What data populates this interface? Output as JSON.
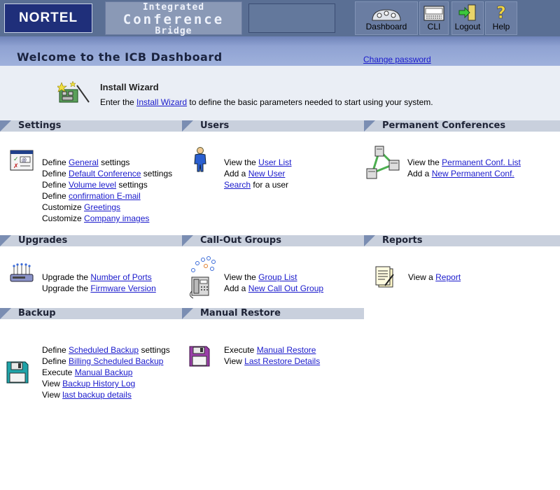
{
  "header": {
    "logo_text": "NORTEL",
    "product_line1": "Integrated",
    "product_line2": "Conference",
    "product_line3": "Bridge",
    "nav": {
      "dashboard": "Dashboard",
      "cli": "CLI",
      "logout": "Logout",
      "help": "Help"
    }
  },
  "welcome": {
    "title": "Welcome to the ICB Dashboard",
    "change_password": "Change password"
  },
  "wizard": {
    "title": "Install Wizard",
    "desc_pre": "Enter the ",
    "desc_link": "Install Wizard",
    "desc_post": " to define the basic parameters needed to start using your system."
  },
  "sections": {
    "settings": {
      "title": "Settings",
      "l1_pre": "Define ",
      "l1_link": "General",
      "l1_post": " settings",
      "l2_pre": "Define ",
      "l2_link": "Default Conference",
      "l2_post": " settings",
      "l3_pre": "Define ",
      "l3_link": "Volume level",
      "l3_post": " settings",
      "l4_pre": "Define ",
      "l4_link": "confirmation E-mail",
      "l5_pre": "Customize ",
      "l5_link": "Greetings",
      "l6_pre": "Customize ",
      "l6_link": "Company images"
    },
    "users": {
      "title": "Users",
      "l1_pre": "View the ",
      "l1_link": "User List",
      "l2_pre": "Add a ",
      "l2_link": "New User",
      "l3_link": "Search",
      "l3_post": " for a user"
    },
    "permanent": {
      "title": "Permanent Conferences",
      "l1_pre": "View the ",
      "l1_link": "Permanent Conf. List",
      "l2_pre": "Add a ",
      "l2_link": "New Permanent Conf."
    },
    "upgrades": {
      "title": "Upgrades",
      "l1_pre": "Upgrade the ",
      "l1_link": "Number of Ports",
      "l2_pre": "Upgrade the ",
      "l2_link": "Firmware Version"
    },
    "callout": {
      "title": "Call-Out Groups",
      "l1_pre": "View the ",
      "l1_link": "Group List",
      "l2_pre": "Add a ",
      "l2_link": "New Call Out Group"
    },
    "reports": {
      "title": "Reports",
      "l1_pre": "View a ",
      "l1_link": "Report"
    },
    "backup": {
      "title": "Backup",
      "l1_pre": "Define ",
      "l1_link": "Scheduled Backup",
      "l1_post": " settings",
      "l2_pre": "Define ",
      "l2_link": "Billing Scheduled Backup",
      "l3_pre": "Execute ",
      "l3_link": "Manual Backup",
      "l4_pre": "View ",
      "l4_link": "Backup History Log",
      "l5_pre": "View ",
      "l5_link": "last backup details"
    },
    "restore": {
      "title": "Manual Restore",
      "l1_pre": "Execute ",
      "l1_link": "Manual Restore",
      "l2_pre": "View ",
      "l2_link": "Last Restore Details"
    }
  },
  "icons": [
    "dashboard-icon",
    "cli-icon",
    "logout-icon",
    "help-icon",
    "wizard-icon",
    "settings-icon",
    "user-icon",
    "permanent-conference-icon",
    "upgrade-device-icon",
    "call-out-group-icon",
    "report-icon",
    "backup-disk-icon",
    "restore-disk-icon"
  ],
  "colors": {
    "banner": "#5a6f94",
    "welcome_bar": "#9fb1dc",
    "section_header": "#c9d0dd",
    "section_triangle": "#7a8db2",
    "link": "#1a1acc",
    "logo_bg": "#1f2f7a"
  }
}
